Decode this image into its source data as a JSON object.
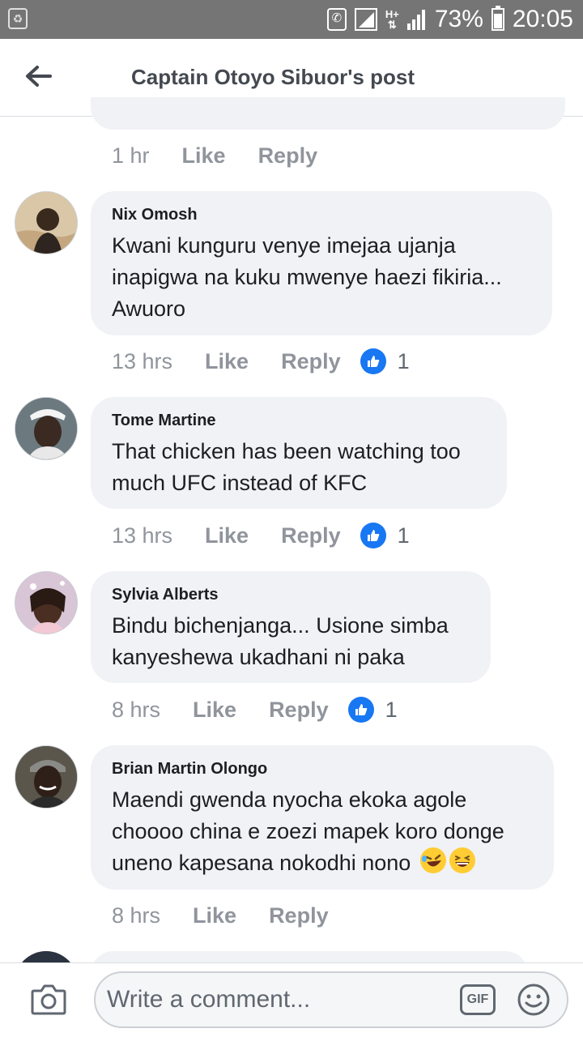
{
  "status_bar": {
    "battery_percent": "73%",
    "battery_level": 0.73,
    "time": "20:05",
    "network_label": "H+"
  },
  "header": {
    "title": "Captain Otoyo Sibuor's post",
    "back_icon": "arrow-left-icon"
  },
  "previous_comment_meta": {
    "time": "1 hr",
    "like_label": "Like",
    "reply_label": "Reply"
  },
  "comments": [
    {
      "author": "Nix Omosh",
      "text": "Kwani kunguru venye imejaa ujanja\ninapigwa na kuku mwenye haezi fikiria...\nAwuoro",
      "time": "13 hrs",
      "like_label": "Like",
      "reply_label": "Reply",
      "reactions": "1"
    },
    {
      "author": "Tome Martine",
      "text": "That chicken has been watching too\nmuch UFC instead of KFC",
      "time": "13 hrs",
      "like_label": "Like",
      "reply_label": "Reply",
      "reactions": "1"
    },
    {
      "author": "Sylvia Alberts",
      "text": "Bindu bichenjanga... Usione simba\nkanyeshewa ukadhani ni paka",
      "time": "8 hrs",
      "like_label": "Like",
      "reply_label": "Reply",
      "reactions": "1"
    },
    {
      "author": "Brian Martin Olongo",
      "text": "Maendi gwenda nyocha ekoka agole\nchoooo china e zoezi mapek koro donge\nuneno kapesana nokodhi nono",
      "emojis": [
        "rolling-on-floor-laughing-emoji",
        "grinning-squinting-emoji"
      ],
      "time": "8 hrs",
      "like_label": "Like",
      "reply_label": "Reply"
    }
  ],
  "composer": {
    "placeholder": "Write a comment...",
    "gif_label": "GIF",
    "camera_icon": "camera-icon",
    "emoji_icon": "smiley-icon"
  },
  "colors": {
    "status_bar": "#757575",
    "bubble": "#f0f2f5",
    "meta_text": "#90949c",
    "like_blue": "#1877f2"
  }
}
